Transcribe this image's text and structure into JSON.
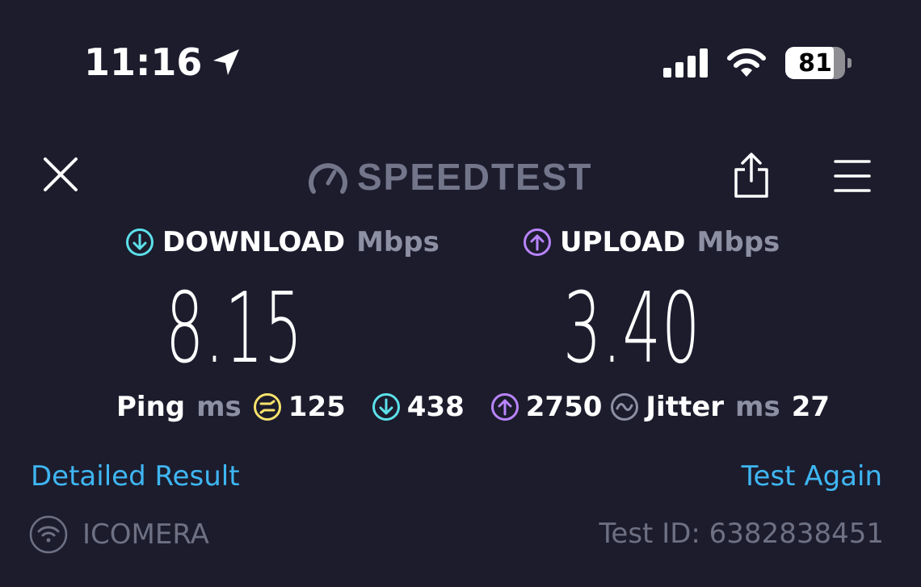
{
  "status_bar": {
    "time": "11:16",
    "battery_level": "81",
    "battery_fraction": 0.81
  },
  "header": {
    "logo_text": "SPEEDTEST",
    "close_icon": "close-icon",
    "share_icon": "share-icon",
    "menu_icon": "hamburger-menu-icon"
  },
  "download": {
    "label": "DOWNLOAD",
    "unit": "Mbps",
    "value": "8.15",
    "color": "#5ce0ea"
  },
  "upload": {
    "label": "UPLOAD",
    "unit": "Mbps",
    "value": "3.40",
    "color": "#b984ff"
  },
  "ping": {
    "label": "Ping",
    "unit": "ms",
    "idle": "125",
    "download": "438",
    "upload": "2750",
    "idle_color": "#f7e26b"
  },
  "jitter": {
    "label": "Jitter",
    "unit": "ms",
    "value": "27"
  },
  "links": {
    "detailed_result": "Detailed Result",
    "test_again": "Test Again"
  },
  "footer": {
    "provider": "ICOMERA",
    "test_id": "Test ID: 6382838451"
  },
  "colors": {
    "background": "#1c1c2d",
    "link": "#3fb6f2",
    "muted": "#8d8fa3"
  }
}
